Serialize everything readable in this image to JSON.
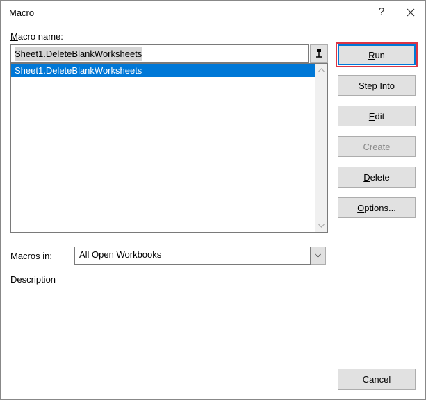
{
  "title": "Macro",
  "labels": {
    "macro_name_pre": "M",
    "macro_name_post": "acro name:",
    "macros_in_pre": "Macros ",
    "macros_in_ul": "i",
    "macros_in_post": "n:",
    "description": "Description"
  },
  "macro_name_value": "Sheet1.DeleteBlankWorksheets",
  "macro_list": {
    "items": [
      "Sheet1.DeleteBlankWorksheets"
    ]
  },
  "macros_in_value": "All Open Workbooks",
  "buttons": {
    "run_ul": "R",
    "run_post": "un",
    "step_ul": "S",
    "step_post": "tep Into",
    "edit_ul": "E",
    "edit_post": "dit",
    "create_ul": "C",
    "create_post": "reate",
    "delete_ul": "D",
    "delete_post": "elete",
    "options_ul": "O",
    "options_post": "ptions...",
    "cancel": "Cancel"
  }
}
